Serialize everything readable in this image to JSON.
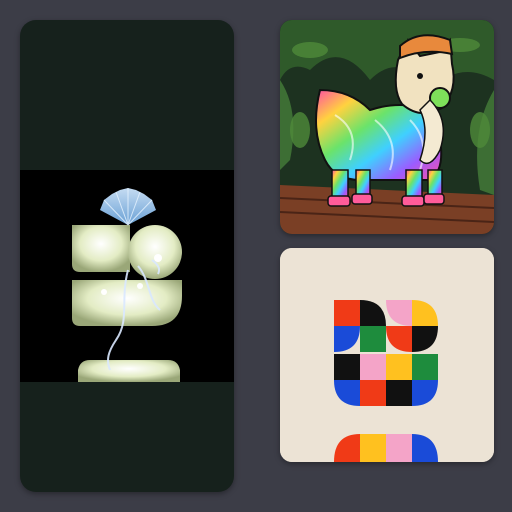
{
  "gallery": {
    "background_color": "#3c3d47",
    "items": [
      {
        "icon": "glowing-flower-sculpture-artwork",
        "background": "#16211c"
      },
      {
        "icon": "psychedelic-shiba-dog-artwork",
        "background": "#22361f"
      },
      {
        "icon": "geometric-color-blocks-artwork",
        "background": "#ece3d5"
      }
    ]
  }
}
